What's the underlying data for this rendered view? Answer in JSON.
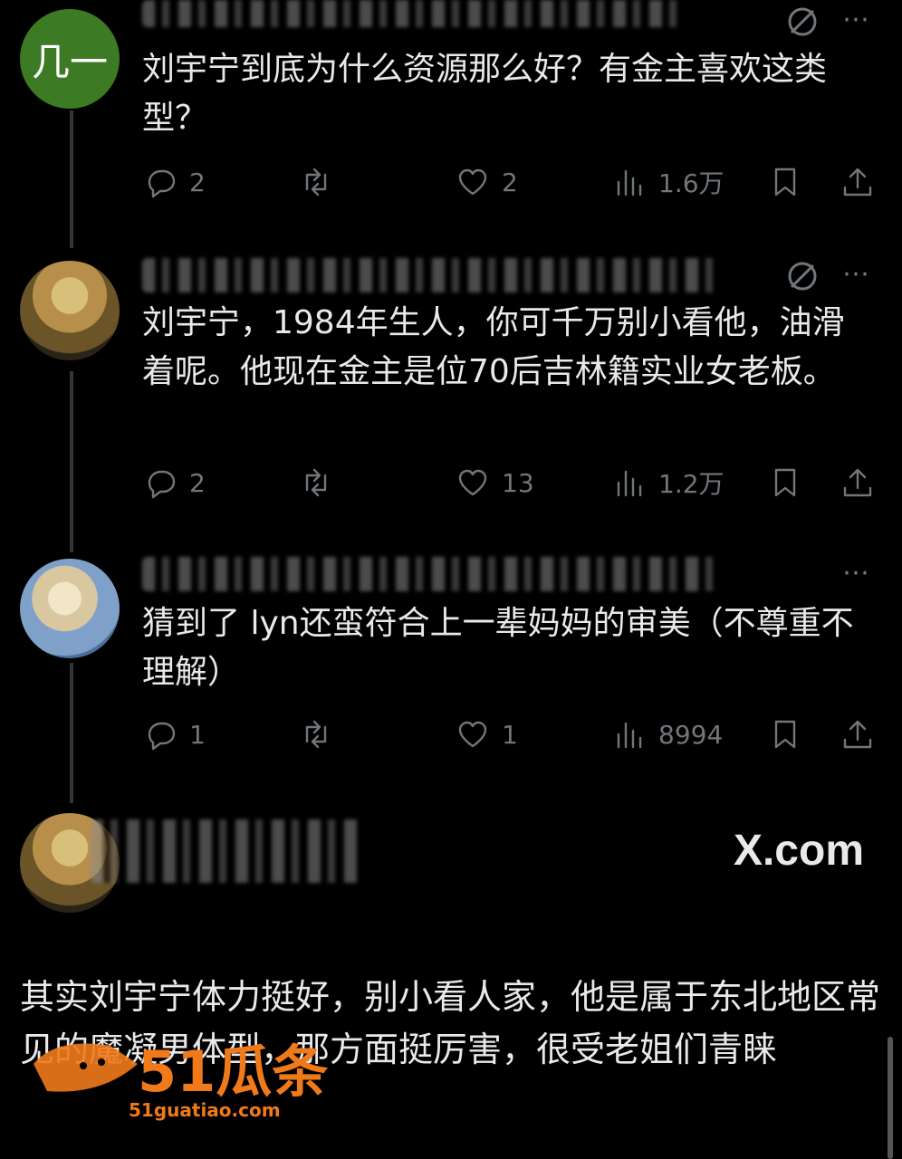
{
  "posts": [
    {
      "avatar_text": "几一",
      "text": "刘宇宁到底为什么资源那么好？有金主喜欢这类型？",
      "replies": "2",
      "likes": "2",
      "views": "1.6万"
    },
    {
      "avatar_text": "",
      "text": "刘宇宁，1984年生人，你可千万别小看他，油滑着呢。他现在金主是位70后吉林籍实业女老板。",
      "replies": "2",
      "likes": "13",
      "views": "1.2万"
    },
    {
      "avatar_text": "",
      "text": "猜到了 lyn还蛮符合上一辈妈妈的审美（不尊重不理解）",
      "replies": "1",
      "likes": "1",
      "views": "8994"
    }
  ],
  "card": {
    "site": "X.com",
    "text": "其实刘宇宁体力挺好，别小看人家，他是属于东北地区常见的魔凝男体型，那方面挺厉害，很受老姐们青睐"
  },
  "watermark": {
    "brand": "51瓜条",
    "url": "51guatiao.com"
  },
  "colors": {
    "background": "#000000",
    "text": "#e7e9ea",
    "icon": "#71767b",
    "avatar_green": "#3d7a24",
    "watermark_orange": "#f07a1a"
  },
  "icons": [
    "reply-icon",
    "retweet-icon",
    "like-icon",
    "views-icon",
    "bookmark-icon",
    "share-icon",
    "grok-icon",
    "more-icon"
  ]
}
